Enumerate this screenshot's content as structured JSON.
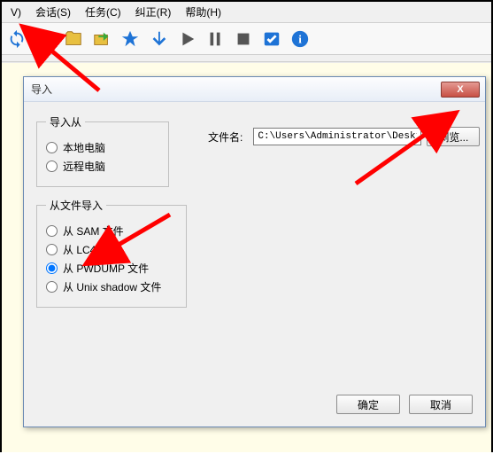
{
  "menu": {
    "view": "V)",
    "session": "会话(S)",
    "task": "任务(C)",
    "correct": "纠正(R)",
    "help": "帮助(H)"
  },
  "toolbar_icons": {
    "refresh": "refresh-icon",
    "open": "open-icon",
    "folder": "folder-icon",
    "export": "export-icon",
    "wizard": "wizard-icon",
    "down": "down-icon",
    "play": "play-icon",
    "pause": "pause-icon",
    "stop": "stop-icon",
    "check": "check-icon",
    "info": "info-icon"
  },
  "dialog": {
    "title": "导入",
    "close": "X",
    "group_from": "导入从",
    "from_local": "本地电脑",
    "from_remote": "远程电脑",
    "group_file": "从文件导入",
    "file_sam": "从 SAM 文件",
    "file_lc4": "从 LC4 文件",
    "file_pwdump": "从 PWDUMP 文件",
    "file_unix": "从 Unix shadow 文件",
    "filename_label": "文件名:",
    "filename_value": "C:\\Users\\Administrator\\Deskto",
    "browse": "浏览...",
    "ok": "确定",
    "cancel": "取消"
  },
  "selected": {
    "from": "local",
    "file": "pwdump"
  },
  "arrow_color": "#ff0000"
}
